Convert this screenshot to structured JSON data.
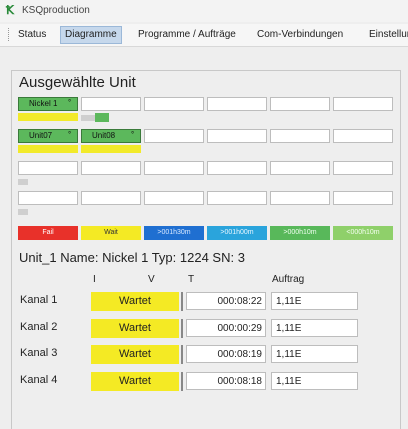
{
  "window": {
    "title": "KSQproduction",
    "logo_glyph": "Ꝁ"
  },
  "menu": [
    {
      "label": "Status",
      "active": false
    },
    {
      "label": "Diagramme",
      "active": true
    },
    {
      "label": "Programme / Aufträge",
      "active": false
    },
    {
      "label": "Com-Verbindungen",
      "active": false
    },
    {
      "label": "Einstellun",
      "active": false
    }
  ],
  "units_panel": {
    "title": "Ausgewählte Unit",
    "row1": [
      {
        "label": "Nickel 1",
        "dot": "°"
      }
    ],
    "row2": [
      {
        "label": "Unit07",
        "dot": "°"
      },
      {
        "label": "Unit08",
        "dot": "°"
      }
    ]
  },
  "legend": [
    {
      "label": "Fail",
      "bg": "#e8312a",
      "fg": "#ffffff"
    },
    {
      "label": "Wait",
      "bg": "#f4ea24",
      "fg": "#333333"
    },
    {
      "label": ">001h30m",
      "bg": "#1f6fd1",
      "fg": "#d8e8ff"
    },
    {
      "label": ">001h00m",
      "bg": "#2aa4dc",
      "fg": "#e8f6ff"
    },
    {
      "label": ">000h10m",
      "bg": "#58b85a",
      "fg": "#f0fff0"
    },
    {
      "label": "<000h10m",
      "bg": "#8fd06a",
      "fg": "#f4fff0"
    }
  ],
  "detail": {
    "header": "Unit_1 Name: Nickel 1 Typ: 1224 SN: 3",
    "columns": {
      "i": "I",
      "v": "V",
      "t": "T",
      "auftrag": "Auftrag"
    },
    "channels": [
      {
        "label": "Kanal 1",
        "status": "Wartet",
        "time": "000:08:22",
        "order": "1,11E"
      },
      {
        "label": "Kanal 2",
        "status": "Wartet",
        "time": "000:00:29",
        "order": "1,11E"
      },
      {
        "label": "Kanal 3",
        "status": "Wartet",
        "time": "000:08:19",
        "order": "1,11E"
      },
      {
        "label": "Kanal 4",
        "status": "Wartet",
        "time": "000:08:18",
        "order": "1,11E"
      }
    ]
  },
  "colors": {
    "accent": "#c6d8ec",
    "wait_yellow": "#f4ea24",
    "unit_green": "#5cb85c"
  }
}
